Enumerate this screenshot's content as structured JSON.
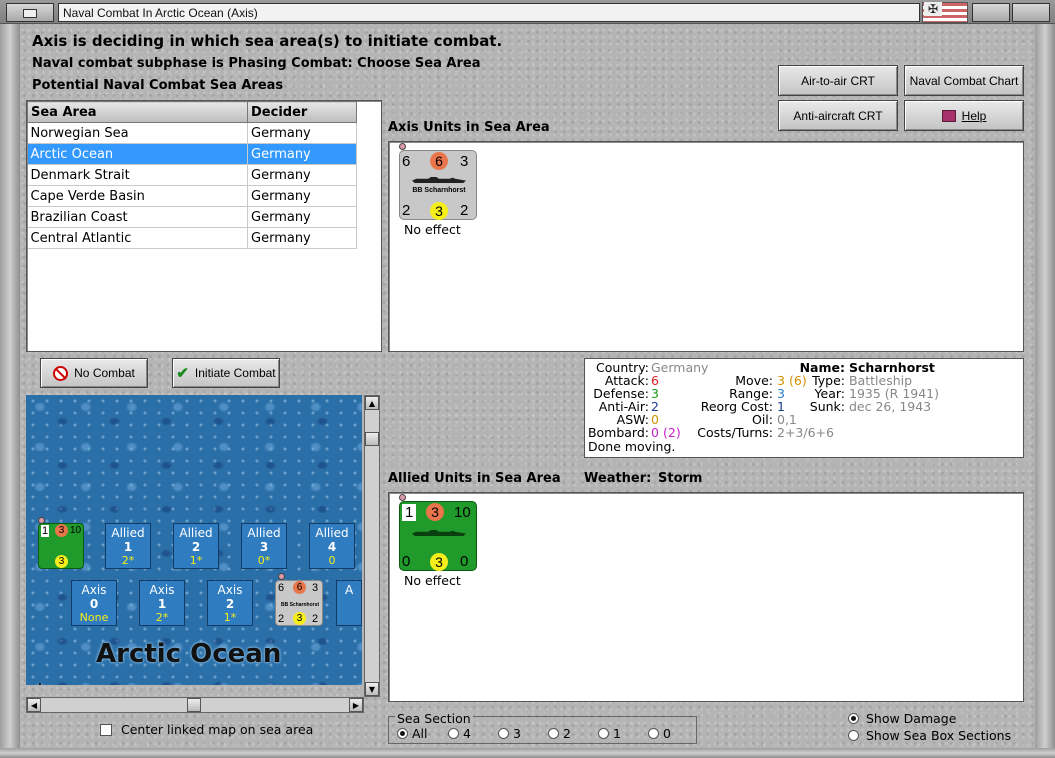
{
  "window": {
    "title": "Naval Combat In Arctic Ocean (Axis)"
  },
  "header": {
    "line1": "Axis is deciding in which sea area(s) to initiate combat.",
    "line2": "Naval combat subphase is Phasing Combat: Choose Sea Area",
    "line3": "Potential Naval Combat Sea Areas"
  },
  "buttons": {
    "air_to_air": "Air-to-air CRT",
    "naval_chart": "Naval Combat Chart",
    "anti_aircraft": "Anti-aircraft CRT",
    "help": "Help",
    "no_combat": "No Combat",
    "initiate_combat": "Initiate Combat"
  },
  "sea_table": {
    "headers": [
      "Sea Area",
      "Decider"
    ],
    "rows": [
      {
        "area": "Norwegian Sea",
        "decider": "Germany"
      },
      {
        "area": "Arctic Ocean",
        "decider": "Germany"
      },
      {
        "area": "Denmark Strait",
        "decider": "Germany"
      },
      {
        "area": "Cape Verde Basin",
        "decider": "Germany"
      },
      {
        "area": "Brazilian Coast",
        "decider": "Germany"
      },
      {
        "area": "Central Atlantic",
        "decider": "Germany"
      }
    ],
    "selected_index": 1
  },
  "axis_units": {
    "label": "Axis Units in Sea Area",
    "unit": {
      "top_left": "6",
      "top_mid": "6",
      "top_right": "3",
      "name": "BB Scharnhorst",
      "bot_left": "2",
      "bot_mid": "3",
      "bot_right": "2",
      "status": "No effect"
    }
  },
  "info": {
    "country_k": "Country:",
    "country_v": "Germany",
    "attack_k": "Attack:",
    "attack_v": "6",
    "defense_k": "Defense:",
    "defense_v": "3",
    "antiair_k": "Anti-Air:",
    "antiair_v": "2",
    "asw_k": "ASW:",
    "asw_v": "0",
    "bombard_k": "Bombard:",
    "bombard_v": "0",
    "bombard_v2": "(2)",
    "done": "Done moving.",
    "move_k": "Move:",
    "move_v": "3",
    "move_v2": "(6)",
    "range_k": "Range:",
    "range_v": "3",
    "reorg_k": "Reorg Cost:",
    "reorg_v": "1",
    "oil_k": "Oil:",
    "oil_v": "0,1",
    "costs_k": "Costs/Turns:",
    "costs_v": "2+3/6+6",
    "name_k": "Name:",
    "name_v": "Scharnhorst",
    "type_k": "Type:",
    "type_v": "Battleship",
    "year_k": "Year:",
    "year_v": "1935 (R 1941)",
    "sunk_k": "Sunk:",
    "sunk_v": "dec 26, 1943"
  },
  "allied_units": {
    "label": "Allied Units in Sea Area",
    "weather_label": "Weather:",
    "weather": "Storm",
    "unit": {
      "top_left": "1",
      "top_mid": "3",
      "top_right": "10",
      "bot_left": "0",
      "bot_mid": "3",
      "bot_right": "0",
      "status": "No effect"
    }
  },
  "map": {
    "title": "Arctic Ocean",
    "corner_text": "ack",
    "allied_counter": {
      "tl": "1",
      "tm": "3",
      "tr": "10",
      "bm": "3"
    },
    "allied_boxes": [
      {
        "side": "Allied",
        "num": "1",
        "val": "2*"
      },
      {
        "side": "Allied",
        "num": "2",
        "val": "1*"
      },
      {
        "side": "Allied",
        "num": "3",
        "val": "0*"
      },
      {
        "side": "Allied",
        "num": "4",
        "val": "0"
      }
    ],
    "axis_boxes": [
      {
        "side": "Axis",
        "num": "0",
        "val": "None"
      },
      {
        "side": "Axis",
        "num": "1",
        "val": "2*"
      },
      {
        "side": "Axis",
        "num": "2",
        "val": "1*"
      }
    ],
    "axis_partial": "A",
    "axis_counter": {
      "tl": "6",
      "tm": "6",
      "tr": "3",
      "name": "BB Scharnhorst",
      "bl": "2",
      "bm": "3",
      "br": "2"
    }
  },
  "footer": {
    "center_map": "Center linked map on sea area",
    "sea_section_label": "Sea Section",
    "sections": [
      "All",
      "4",
      "3",
      "2",
      "1",
      "0"
    ],
    "selected_section": "All",
    "show_damage": "Show Damage",
    "show_boxes": "Show Sea Box Sections"
  }
}
